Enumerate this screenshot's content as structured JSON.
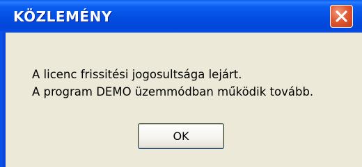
{
  "dialog": {
    "title": "KÖZLEMÉNY",
    "message_line1": "A licenc frissitési jogosultsága lejárt.",
    "message_line2": "A program DEMO üzemmódban működik tovább.",
    "ok_label": "OK"
  },
  "icons": {
    "close": "close-icon"
  },
  "colors": {
    "titlebar": "#0350e5",
    "client_background": "#ece9d8",
    "close_button": "#e15a33"
  }
}
